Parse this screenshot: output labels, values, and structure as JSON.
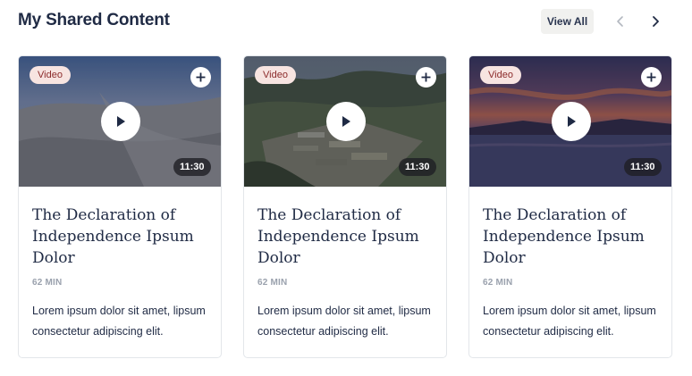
{
  "header": {
    "title": "My Shared Content",
    "view_all_label": "View All",
    "prev_icon": "chevron-left-icon",
    "next_icon": "chevron-right-icon"
  },
  "colors": {
    "title": "#1f2a44",
    "badge_bg": "#f7e4e1",
    "badge_text": "#8c2b2b",
    "meta": "#9aa1ad"
  },
  "cards": [
    {
      "badge": "Video",
      "duration": "11:30",
      "title": "The Declaration of Independence Ipsum Dolor",
      "meta": "62 MIN",
      "description": "Lorem ipsum dolor sit amet, lipsum consectetur adipiscing elit.",
      "thumbnail": "desert-dunes"
    },
    {
      "badge": "Video",
      "duration": "11:30",
      "title": "The Declaration of Independence Ipsum Dolor",
      "meta": "62 MIN",
      "description": "Lorem ipsum dolor sit amet, lipsum consectetur adipiscing elit.",
      "thumbnail": "aerial-farmland"
    },
    {
      "badge": "Video",
      "duration": "11:30",
      "title": "The Declaration of Independence Ipsum Dolor",
      "meta": "62 MIN",
      "description": "Lorem ipsum dolor sit amet, lipsum consectetur adipiscing elit.",
      "thumbnail": "sunset-lake"
    }
  ]
}
